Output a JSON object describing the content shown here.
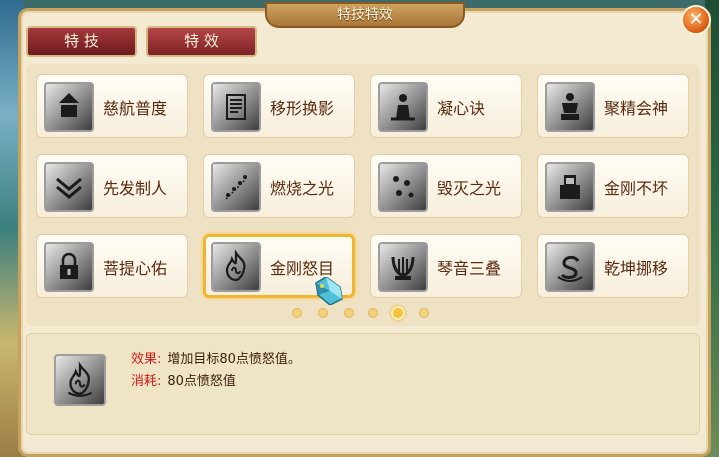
{
  "window": {
    "title": "特技特效",
    "close_label": "✕"
  },
  "tabs": [
    {
      "label": "特 技",
      "active": true
    },
    {
      "label": "特 效",
      "active": false
    }
  ],
  "skills": [
    {
      "name": "慈航普度",
      "icon": "temple-icon"
    },
    {
      "name": "移形换影",
      "icon": "scroll-icon"
    },
    {
      "name": "凝心诀",
      "icon": "meditating-figure-icon"
    },
    {
      "name": "聚精会神",
      "icon": "statue-icon"
    },
    {
      "name": "先发制人",
      "icon": "chevron-arrows-icon"
    },
    {
      "name": "燃烧之光",
      "icon": "sparks-icon"
    },
    {
      "name": "毁灭之光",
      "icon": "falling-stars-icon"
    },
    {
      "name": "金刚不坏",
      "icon": "throne-icon"
    },
    {
      "name": "菩提心佑",
      "icon": "lock-icon"
    },
    {
      "name": "金刚怒目",
      "icon": "flame-icon",
      "selected": true
    },
    {
      "name": "琴音三叠",
      "icon": "lyre-icon"
    },
    {
      "name": "乾坤挪移",
      "icon": "swirl-icon"
    }
  ],
  "pagination": {
    "total": 6,
    "current": 5
  },
  "detail": {
    "icon": "flame-icon",
    "effect_label": "效果:",
    "effect_text": "增加目标80点愤怒值。",
    "cost_label": "消耗:",
    "cost_text": "80点愤怒值"
  },
  "colors": {
    "accent_gold": "#f2b530",
    "tab_red": "#8a2226",
    "label_red": "#d21a1a"
  }
}
